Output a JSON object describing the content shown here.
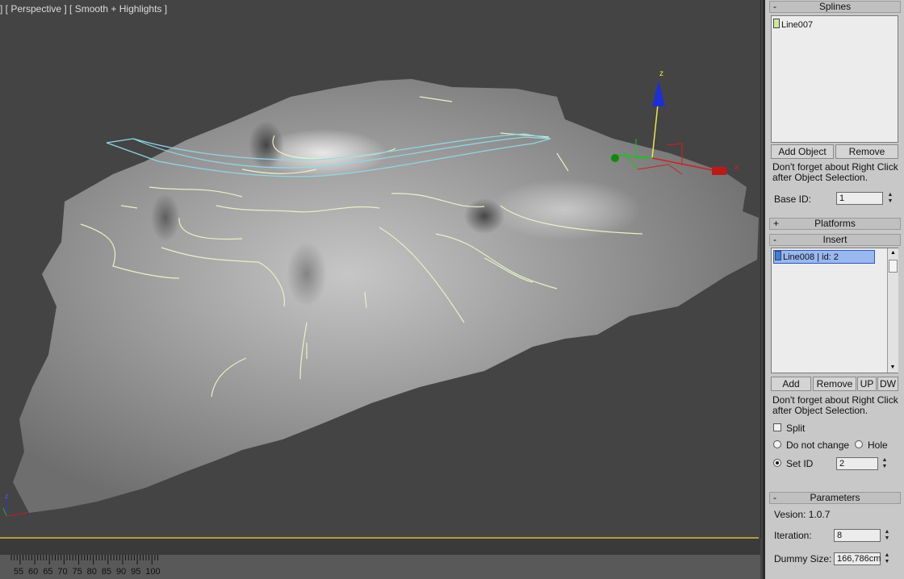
{
  "viewport": {
    "label": "] [ Perspective ] [ Smooth + Highlights ]",
    "gizmo_axis_z": "z",
    "gizmo_axis_x": "x",
    "corner_axis_z": "z"
  },
  "timeline": {
    "ticks": [
      "55",
      "60",
      "65",
      "70",
      "75",
      "80",
      "85",
      "90",
      "95",
      "100"
    ]
  },
  "splines": {
    "title": "Splines",
    "collapse": "-",
    "items": [
      {
        "label": "Line007",
        "color": "#cfe7a0"
      }
    ],
    "add_label": "Add Object",
    "remove_label": "Remove",
    "note_line1": "Don't forget about Right Click",
    "note_line2": "after Object Selection.",
    "base_id_label": "Base ID:",
    "base_id_value": "1"
  },
  "platforms": {
    "title": "Platforms",
    "expand": "+"
  },
  "insert": {
    "title": "Insert",
    "collapse": "-",
    "items": [
      {
        "label": "Line008 | id: 2",
        "color": "#3d7de0",
        "selected": true
      }
    ],
    "add_label": "Add",
    "remove_label": "Remove",
    "up_label": "UP",
    "dw_label": "DW",
    "note_line1": "Don't forget about Right Click",
    "note_line2": "after Object Selection.",
    "split_label": "Split",
    "do_not_change_label": "Do not change",
    "hole_label": "Hole",
    "set_id_label": "Set ID",
    "set_id_value": "2"
  },
  "parameters": {
    "title": "Parameters",
    "collapse": "-",
    "version_label": "Vesion: 1.0.7",
    "iteration_label": "Iteration:",
    "iteration_value": "8",
    "dummy_size_label": "Dummy Size:",
    "dummy_size_value": "166,786cm"
  }
}
